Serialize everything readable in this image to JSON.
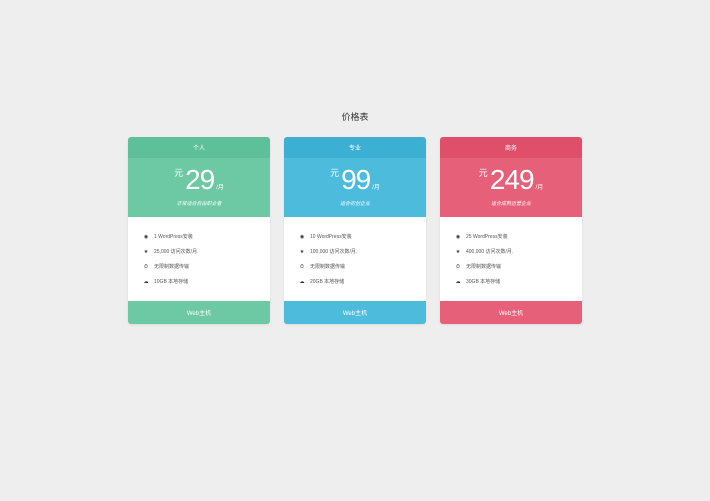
{
  "page_title": "价格表",
  "currency_label": "元",
  "period_label": "/月",
  "footer_label": "Web主机",
  "feature_icons": [
    "check-circle-icon",
    "star-icon",
    "dashboard-icon",
    "cloud-icon"
  ],
  "plans": [
    {
      "name": "个人",
      "price": "29",
      "tagline": "非常适合自由职业者",
      "features": [
        "1 WordPress安装",
        "25,000 访问次数/月.",
        "无限制数据传输",
        "10GB 本地存储"
      ]
    },
    {
      "name": "专业",
      "price": "99",
      "tagline": "适合初创企业",
      "features": [
        "10 WordPress安装",
        "100,000 访问次数/月.",
        "无限制数据传输",
        "20GB 本地存储"
      ]
    },
    {
      "name": "商务",
      "price": "249",
      "tagline": "适合成熟运营企业",
      "features": [
        "25 WordPress安装",
        "400,000 访问次数/月.",
        "无限制数据传输",
        "30GB 本地存储"
      ]
    }
  ]
}
